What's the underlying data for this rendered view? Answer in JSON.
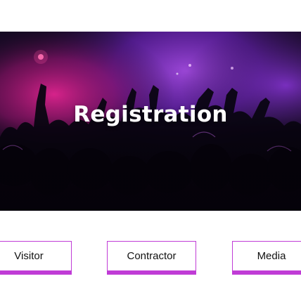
{
  "hero": {
    "title": "Registration"
  },
  "buttons": [
    {
      "label": "Visitor"
    },
    {
      "label": "Contractor"
    },
    {
      "label": "Media"
    }
  ],
  "colors": {
    "accent": "#c03cd6",
    "hero_purple": "#7a2fd0",
    "hero_magenta": "#d01a9a"
  }
}
